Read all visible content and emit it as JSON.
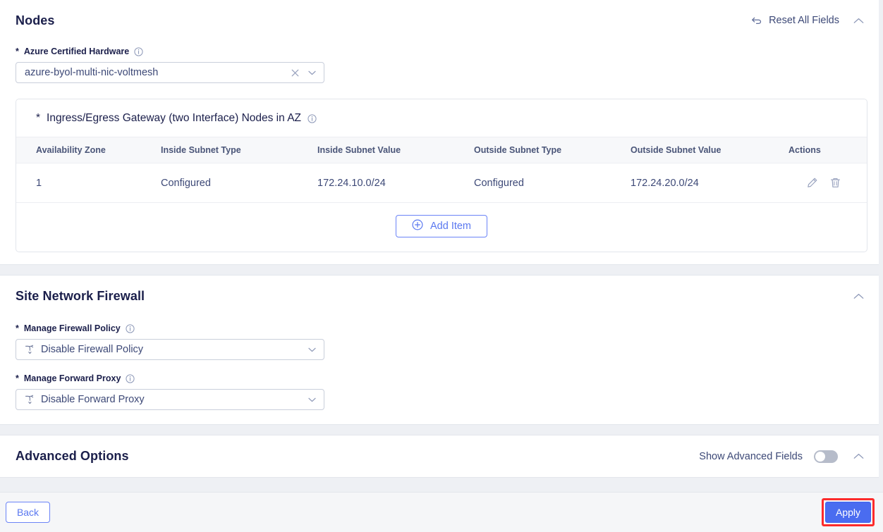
{
  "nodes": {
    "title": "Nodes",
    "reset_label": "Reset All Fields",
    "reset_icon": "undo-arrow-icon",
    "collapse_icon": "chevron-up-icon",
    "hardware": {
      "label": "Azure Certified Hardware",
      "required_mark": "*",
      "info_icon": "info-icon",
      "value": "azure-byol-multi-nic-voltmesh",
      "clear_icon": "close-icon",
      "caret_icon": "chevron-down-icon"
    },
    "gateway_card": {
      "title": "Ingress/Egress Gateway (two Interface) Nodes in AZ",
      "required_mark": "*",
      "info_icon": "info-icon",
      "columns": [
        "Availability Zone",
        "Inside Subnet Type",
        "Inside Subnet Value",
        "Outside Subnet Type",
        "Outside Subnet Value",
        "Actions"
      ],
      "rows": [
        {
          "availability_zone": "1",
          "inside_subnet_type": "Configured",
          "inside_subnet_value": "172.24.10.0/24",
          "outside_subnet_type": "Configured",
          "outside_subnet_value": "172.24.20.0/24",
          "edit_icon": "pencil-icon",
          "delete_icon": "trash-icon"
        }
      ],
      "add_item_label": "Add Item",
      "add_item_icon": "plus-circle-icon"
    }
  },
  "firewall": {
    "title": "Site Network Firewall",
    "collapse_icon": "chevron-up-icon",
    "policy": {
      "label": "Manage Firewall Policy",
      "required_mark": "*",
      "info_icon": "info-icon",
      "leading_icon": "branch-arrow-icon",
      "value": "Disable Firewall Policy",
      "caret_icon": "chevron-down-icon"
    },
    "proxy": {
      "label": "Manage Forward Proxy",
      "required_mark": "*",
      "info_icon": "info-icon",
      "leading_icon": "branch-arrow-icon",
      "value": "Disable Forward Proxy",
      "caret_icon": "chevron-down-icon"
    }
  },
  "advanced": {
    "title": "Advanced Options",
    "show_fields_label": "Show Advanced Fields",
    "toggle_state": "off",
    "collapse_icon": "chevron-up-icon"
  },
  "footer": {
    "back_label": "Back",
    "apply_label": "Apply"
  },
  "colors": {
    "accent_blue": "#4a6cf0",
    "link_blue": "#5a78f0",
    "heading_navy": "#1b1f4b",
    "body_text": "#3d4977",
    "highlight_red": "#fc2b2b",
    "page_bg": "#eef0f4",
    "panel_bg": "#ffffff"
  }
}
